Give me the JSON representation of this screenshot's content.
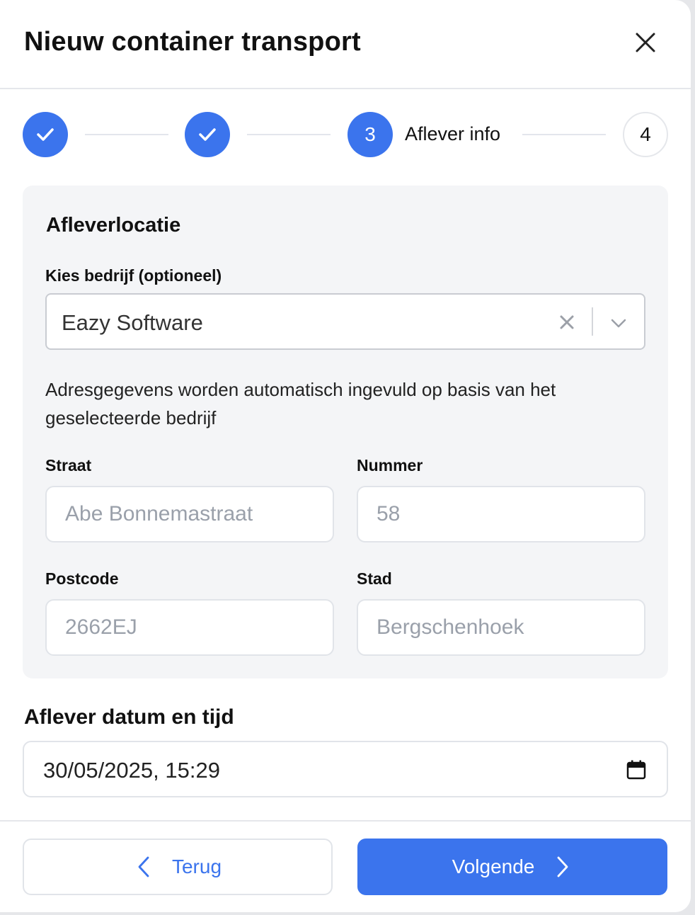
{
  "dialog": {
    "title": "Nieuw container transport"
  },
  "stepper": {
    "steps": [
      {
        "state": "done",
        "icon": "check-icon"
      },
      {
        "state": "done",
        "icon": "check-icon"
      },
      {
        "state": "active",
        "number": "3",
        "label": "Aflever info"
      },
      {
        "state": "todo",
        "number": "4"
      }
    ]
  },
  "location": {
    "title": "Afleverlocatie",
    "company_label": "Kies bedrijf (optioneel)",
    "company_value": "Eazy Software",
    "helper": "Adresgegevens worden automatisch ingevuld op basis van het geselecteerde bedrijf",
    "street_label": "Straat",
    "street_placeholder": "Abe Bonnemastraat",
    "number_label": "Nummer",
    "number_placeholder": "58",
    "postcode_label": "Postcode",
    "postcode_placeholder": "2662EJ",
    "city_label": "Stad",
    "city_placeholder": "Bergschenhoek"
  },
  "delivery": {
    "title": "Aflever datum en tijd",
    "datetime_value": "30/05/2025, 15:29"
  },
  "footer": {
    "back_label": "Terug",
    "next_label": "Volgende"
  },
  "colors": {
    "accent": "#3b74ed",
    "panel_bg": "#f4f5f7",
    "border": "#e1e4e9"
  }
}
